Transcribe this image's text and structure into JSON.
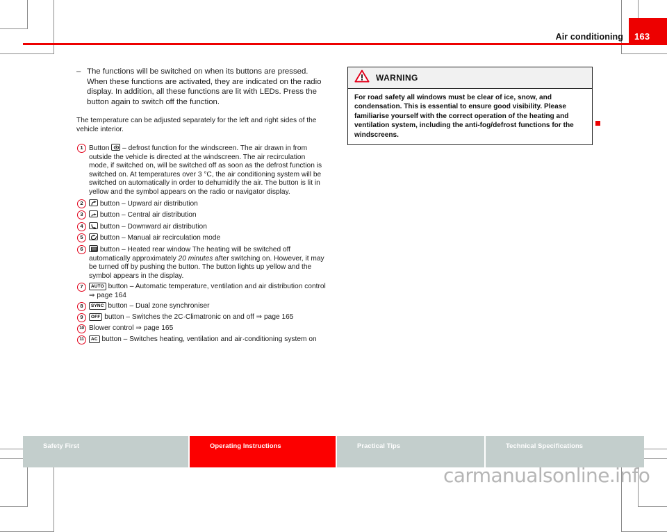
{
  "header": {
    "title": "Air conditioning",
    "page_number": "163"
  },
  "left_column": {
    "dash_mark": "–",
    "intro_bullet": "The functions will be switched on when its buttons are pressed. When these functions are activated, they are indicated on the radio display. In addition, all these functions are lit with LEDs. Press the button again to switch off the function.",
    "paragraph": "The temperature can be adjusted separately for the left and right sides of the vehicle interior.",
    "legend": [
      {
        "number": "1",
        "icon": "defrost-windscreen-icon",
        "text_parts": {
          "prefix": "Button ",
          "suffix": " – defrost function for the windscreen. The air drawn in from outside the vehicle is directed at the windscreen. The air recirculation mode, if switched on, will be switched off as soon as the defrost function is switched on. At temperatures over 3 °C, the air conditioning system will be switched on automatically in order to dehumidify the air. The button is lit in yellow and the symbol appears on the radio or navigator display."
        }
      },
      {
        "number": "2",
        "icon": "air-up-icon",
        "text_parts": {
          "prefix": "",
          "suffix": " button – Upward air distribution"
        }
      },
      {
        "number": "3",
        "icon": "air-central-icon",
        "text_parts": {
          "prefix": "",
          "suffix": " button – Central air distribution"
        }
      },
      {
        "number": "4",
        "icon": "air-down-icon",
        "text_parts": {
          "prefix": "",
          "suffix": " button – Downward air distribution"
        }
      },
      {
        "number": "5",
        "icon": "air-recirculation-icon",
        "text_parts": {
          "prefix": "",
          "suffix": " button – Manual air recirculation mode"
        }
      },
      {
        "number": "6",
        "icon": "heated-rear-window-icon",
        "text_parts": {
          "prefix": "",
          "suffix_a": " button – Heated rear window The heating will be switched off automatically approximately ",
          "emphasis": "20 minutes",
          "suffix_b": " after switching on. However, it may be turned off by pushing the button. The button lights up yellow and the symbol appears in the display."
        }
      },
      {
        "number": "7",
        "key_label": "AUTO",
        "text_parts": {
          "prefix": "",
          "suffix": " button – Automatic temperature, ventilation and air distribution control ⇒ page 164"
        }
      },
      {
        "number": "8",
        "key_label": "SYNC",
        "text_parts": {
          "prefix": "",
          "suffix": " button – Dual zone synchroniser"
        }
      },
      {
        "number": "9",
        "key_label": "OFF",
        "text_parts": {
          "prefix": "",
          "suffix": " button – Switches the 2C·Climatronic on and off ⇒ page 165"
        }
      },
      {
        "number": "10",
        "key_label": "",
        "text_parts": {
          "prefix": "",
          "suffix": "Blower control ⇒ page 165"
        }
      },
      {
        "number": "11",
        "key_label": "AC",
        "text_parts": {
          "prefix": "",
          "suffix": " button – Switches heating, ventilation and air·conditioning system on"
        }
      }
    ]
  },
  "right_column": {
    "warning": {
      "icon": "warning-triangle-icon",
      "title": "WARNING",
      "body": "For road safety all windows must be clear of ice, snow, and condensation. This is essential to ensure good visibility. Please familiarise yourself with the correct operation of the heating and ventilation system, including the anti-fog/defrost functions for the windscreens."
    },
    "end_marker": "red-square-marker"
  },
  "footer": {
    "tabs": [
      {
        "label": "Safety First",
        "active": false
      },
      {
        "label": "Operating Instructions",
        "active": true
      },
      {
        "label": "Practical Tips",
        "active": false
      },
      {
        "label": "Technical Specifications",
        "active": false
      }
    ],
    "watermark": "carmanualsonline.info"
  },
  "colors": {
    "brand_red": "#ed0000",
    "tab_red": "#fc0000",
    "tab_grey": "#c3cecc",
    "circle_red": "#e2001a"
  }
}
